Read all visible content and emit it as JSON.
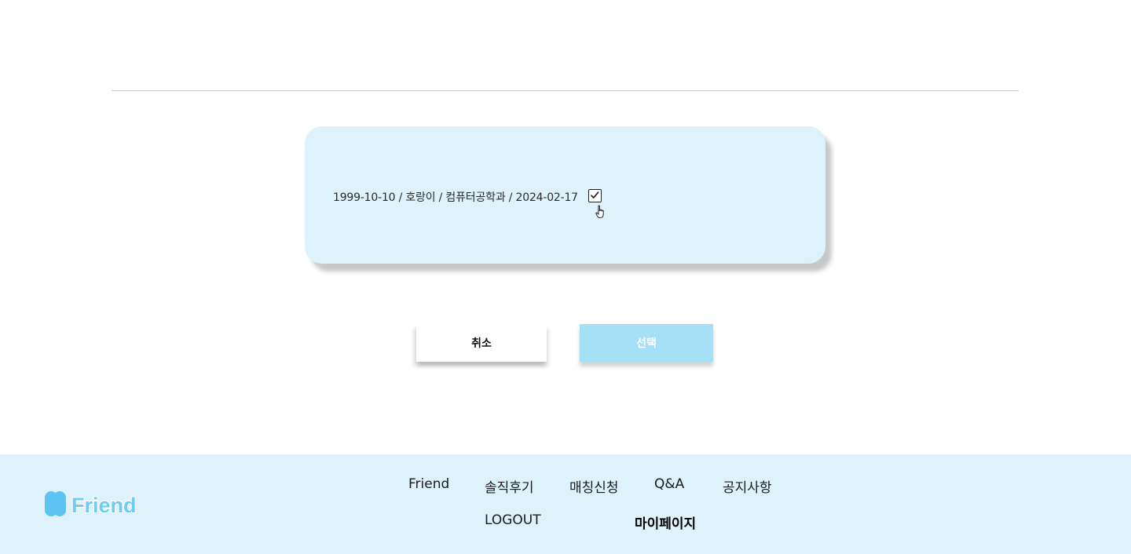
{
  "card": {
    "info_text": "1999-10-10 / 호랑이 / 컴퓨터공학과 / 2024-02-17",
    "checkbox_checked": true
  },
  "buttons": {
    "cancel_label": "취소",
    "select_label": "선택"
  },
  "footer": {
    "logo_text": "Friend",
    "nav": {
      "friend": "Friend",
      "reviews": "솔직후기",
      "matching": "매칭신청",
      "qna": "Q&A",
      "notice": "공지사항",
      "logout": "LOGOUT",
      "mypage": "마이페이지"
    }
  },
  "colors": {
    "card_bg": "#ddf2fb",
    "footer_bg": "#ddf2fb",
    "select_button_bg": "#a6e0f6",
    "logo_blue": "#5cc4f2"
  }
}
